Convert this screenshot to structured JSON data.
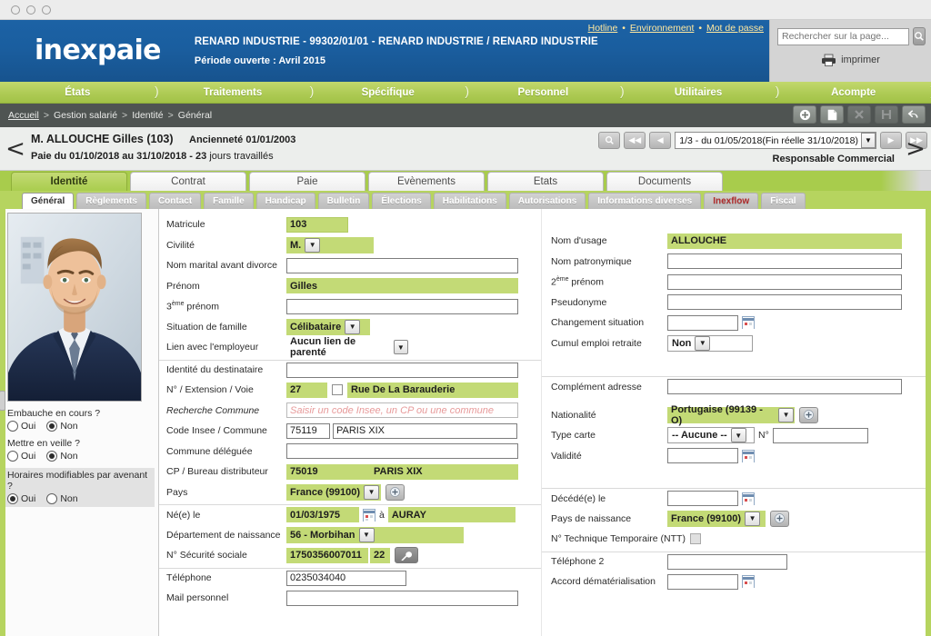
{
  "window": {
    "dots": 3
  },
  "brand": {
    "logo": "inexpaie",
    "company": "RENARD INDUSTRIE - 99302/01/01 - RENARD INDUSTRIE / RENARD INDUSTRIE",
    "period": "Période ouverte : Avril 2015",
    "links": [
      {
        "label": "Hotline",
        "name": "hotline-link"
      },
      {
        "label": "Environnement",
        "name": "environnement-link"
      },
      {
        "label": "Mot de passe",
        "name": "mot-de-passe-link"
      }
    ],
    "search_placeholder": "Rechercher sur la page...",
    "search_value": "",
    "print_label": "imprimer"
  },
  "mainnav": [
    {
      "label": "États"
    },
    {
      "label": "Traitements"
    },
    {
      "label": "Spécifique"
    },
    {
      "label": "Personnel"
    },
    {
      "label": "Utilitaires"
    },
    {
      "label": "Acompte"
    }
  ],
  "breadcrumb": [
    "Accueil",
    "Gestion salarié",
    "Identité",
    "Général"
  ],
  "crumb_tools": [
    {
      "name": "add-record-button",
      "icon": "plus-icon",
      "enabled": true
    },
    {
      "name": "duplicate-record-button",
      "icon": "document-icon",
      "enabled": true
    },
    {
      "name": "delete-record-button",
      "icon": "close-icon",
      "enabled": false
    },
    {
      "name": "save-record-button",
      "icon": "save-icon",
      "enabled": false
    },
    {
      "name": "undo-button",
      "icon": "undo-arrow-icon",
      "enabled": true
    }
  ],
  "employee": {
    "name_line": "M. ALLOUCHE  Gilles  (103)",
    "seniority": "Ancienneté 01/01/2003",
    "pay_line_bold": "Paie du 01/10/2018 au 31/10/2018 - 23",
    "pay_line_thin": "jours travaillés",
    "role": "Responsable Commercial",
    "period_selected": "1/3 - du 01/05/2018(Fin réelle 31/10/2018)",
    "nav_buttons": [
      "◀◀",
      "◀",
      "▶",
      "▶▶"
    ],
    "prev_arrow": "<",
    "next_arrow": ">"
  },
  "tabs1": [
    {
      "label": "Identité",
      "active": true
    },
    {
      "label": "Contrat",
      "active": false
    },
    {
      "label": "Paie",
      "active": false
    },
    {
      "label": "Evènements",
      "active": false
    },
    {
      "label": "Etats",
      "active": false
    },
    {
      "label": "Documents",
      "active": false
    }
  ],
  "tabs2": [
    {
      "label": "Général",
      "active": true,
      "alt": false
    },
    {
      "label": "Règlements",
      "active": false,
      "alt": false
    },
    {
      "label": "Contact",
      "active": false,
      "alt": false
    },
    {
      "label": "Famille",
      "active": false,
      "alt": false
    },
    {
      "label": "Handicap",
      "active": false,
      "alt": false
    },
    {
      "label": "Bulletin",
      "active": false,
      "alt": false
    },
    {
      "label": "Élections",
      "active": false,
      "alt": false
    },
    {
      "label": "Habilitations",
      "active": false,
      "alt": false
    },
    {
      "label": "Autorisations",
      "active": false,
      "alt": false
    },
    {
      "label": "Informations diverses",
      "active": false,
      "alt": false
    },
    {
      "label": "Inexflow",
      "active": false,
      "alt": true
    },
    {
      "label": "Fiscal",
      "active": false,
      "alt": false
    }
  ],
  "sidebar": {
    "photo_alt": "employee-photo",
    "questions": [
      {
        "label": "Embauche en cours ?",
        "yes": "Oui",
        "no": "Non",
        "selected": "no",
        "shaded": false
      },
      {
        "label": "Mettre en veille ?",
        "yes": "Oui",
        "no": "Non",
        "selected": "no",
        "shaded": false
      },
      {
        "label": "Horaires modifiables par avenant ?",
        "yes": "Oui",
        "no": "Non",
        "selected": "yes",
        "shaded": true
      }
    ]
  },
  "form": {
    "left": {
      "matricule_label": "Matricule",
      "matricule_value": "103",
      "civilite_label": "Civilité",
      "civilite_value": "M.",
      "nom_marital_label": "Nom marital avant divorce",
      "nom_marital_value": "",
      "prenom_label": "Prénom",
      "prenom_value": "Gilles",
      "prenom3_label": "3ème prénom",
      "prenom3_value": "",
      "situation_label": "Situation de famille",
      "situation_value": "Célibataire",
      "lien_label": "Lien avec l'employeur",
      "lien_value": "Aucun lien de parenté",
      "destinataire_label": "Identité du destinataire",
      "destinataire_value": "",
      "voie_label": "N° / Extension / Voie",
      "voie_num": "27",
      "voie_name": "Rue De La Barauderie",
      "recherche_label": "Recherche Commune",
      "recherche_placeholder": "Saisir un code Insee, un CP ou une commune",
      "insee_label": "Code Insee / Commune",
      "insee_code": "75119",
      "insee_commune": "PARIS XIX",
      "deleguee_label": "Commune déléguée",
      "deleguee_value": "",
      "cp_label": "CP / Bureau distributeur",
      "cp_code": "75019",
      "cp_bureau": "PARIS XIX",
      "pays_label": "Pays",
      "pays_value": "France (99100)",
      "naissance_label": "Né(e) le",
      "naissance_date": "01/03/1975",
      "naissance_a": "à",
      "naissance_ville": "AURAY",
      "departement_label": "Département de naissance",
      "departement_value": "56 - Morbihan",
      "secu_label": "N° Sécurité sociale",
      "secu_value": "1750356007011",
      "secu_key": "22",
      "telephone_label": "Téléphone",
      "telephone_value": "0235034040",
      "mail_label": "Mail personnel",
      "mail_value": ""
    },
    "right": {
      "nom_usage_label": "Nom d'usage",
      "nom_usage_value": "ALLOUCHE",
      "nom_patro_label": "Nom patronymique",
      "nom_patro_value": "",
      "prenom2_label": "2ème prénom",
      "prenom2_value": "",
      "pseudo_label": "Pseudonyme",
      "pseudo_value": "",
      "changement_label": "Changement situation",
      "changement_value": "",
      "cumul_label": "Cumul emploi retraite",
      "cumul_value": "Non",
      "complement_label": "Complément adresse",
      "complement_value": "",
      "nationalite_label": "Nationalité",
      "nationalite_value": "Portugaise (99139 - O)",
      "typecarte_label": "Type carte",
      "typecarte_value": "-- Aucune --",
      "typecarte_num_label": "N°",
      "typecarte_num_value": "",
      "validite_label": "Validité",
      "validite_value": "",
      "decede_label": "Décédé(e) le",
      "decede_value": "",
      "pays_naissance_label": "Pays de naissance",
      "pays_naissance_value": "France (99100)",
      "ntt_label": "N° Technique Temporaire (NTT)",
      "ntt_checked": false,
      "telephone2_label": "Téléphone 2",
      "telephone2_value": "",
      "accord_label": "Accord dématérialisation",
      "accord_value": ""
    }
  },
  "colors": {
    "brand_blue": "#1a5e9f",
    "accent_green": "#a8cc4c",
    "field_green": "#c3da76",
    "crumb_dark": "#4f5452",
    "link_yellow": "#ffe8a0",
    "placeholder_red": "#e79a9a"
  }
}
